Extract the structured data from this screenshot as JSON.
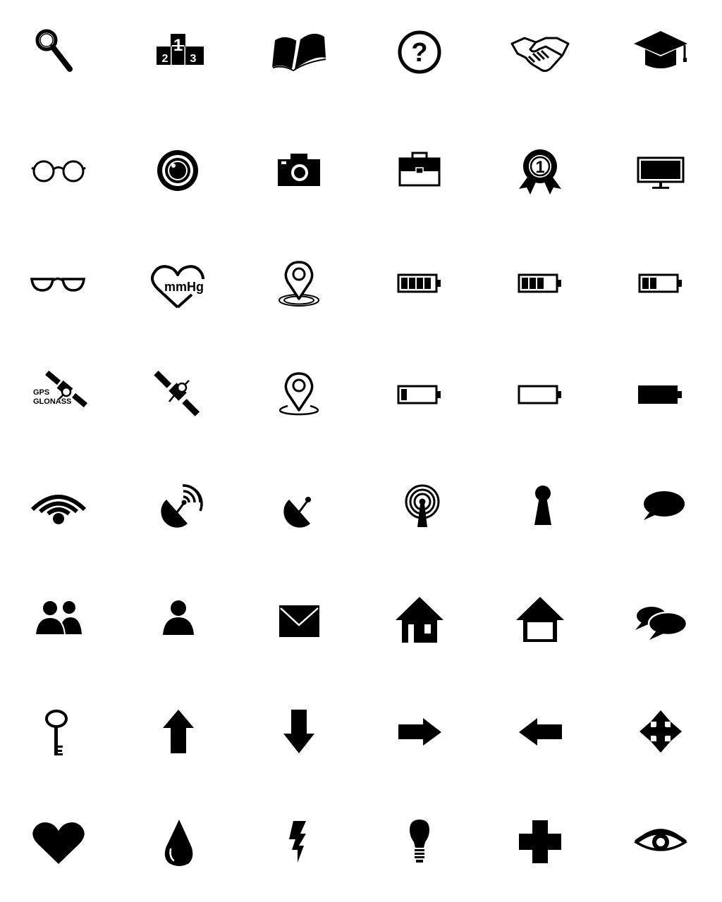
{
  "colors": {
    "icon": "#000000",
    "background": "#ffffff"
  },
  "labels": {
    "podium_first": "1",
    "podium_second": "2",
    "podium_third": "3",
    "question_mark": "?",
    "award_number": "1",
    "blood_pressure_unit": "mmHg",
    "gps_line1": "GPS",
    "gps_line2": "GLONASS"
  },
  "icons": [
    [
      "magnifier-icon",
      "podium-icon",
      "open-book-icon",
      "question-circle-icon",
      "handshake-icon",
      "graduation-cap-icon"
    ],
    [
      "glasses-round-icon",
      "camera-lens-icon",
      "camera-icon",
      "briefcase-icon",
      "award-ribbon-icon",
      "monitor-icon"
    ],
    [
      "glasses-half-icon",
      "blood-pressure-heart-icon",
      "location-pin-ring-icon",
      "battery-full-icon",
      "battery-three-quarter-icon",
      "battery-half-icon"
    ],
    [
      "gps-glonass-satellite-icon",
      "satellite-icon",
      "location-pin-base-icon",
      "battery-low-icon",
      "battery-empty-icon",
      "battery-solid-icon"
    ],
    [
      "wifi-icon",
      "satellite-dish-signal-icon",
      "satellite-dish-icon",
      "radio-tower-icon",
      "keyhole-icon",
      "speech-bubble-icon"
    ],
    [
      "users-icon",
      "user-icon",
      "envelope-icon",
      "home-window-icon",
      "home-outline-icon",
      "chat-bubbles-icon"
    ],
    [
      "key-icon",
      "arrow-up-icon",
      "arrow-down-icon",
      "arrow-right-icon",
      "arrow-left-icon",
      "move-arrows-icon"
    ],
    [
      "heart-icon",
      "water-drop-icon",
      "lightning-icon",
      "light-bulb-icon",
      "medical-cross-icon",
      "eye-icon"
    ]
  ]
}
